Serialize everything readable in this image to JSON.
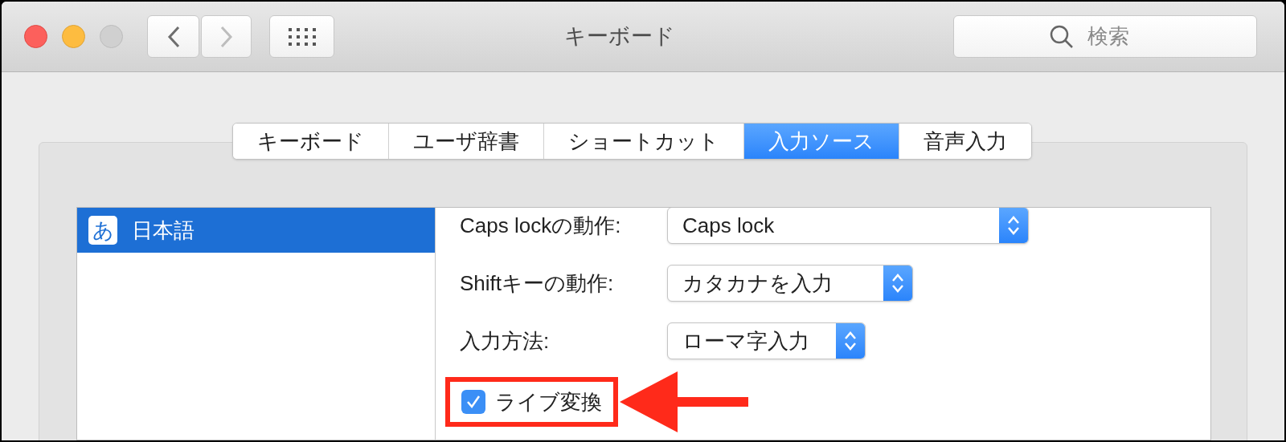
{
  "window": {
    "title": "キーボード"
  },
  "search": {
    "placeholder": "検索"
  },
  "tabs": [
    {
      "label": "キーボード",
      "selected": false
    },
    {
      "label": "ユーザ辞書",
      "selected": false
    },
    {
      "label": "ショートカット",
      "selected": false
    },
    {
      "label": "入力ソース",
      "selected": true
    },
    {
      "label": "音声入力",
      "selected": false
    }
  ],
  "sidebar": {
    "items": [
      {
        "badge": "あ",
        "label": "日本語",
        "selected": true
      }
    ]
  },
  "settings": [
    {
      "kind": "popup",
      "label": "Caps lockの動作:",
      "value": "Caps lock"
    },
    {
      "kind": "popup",
      "label": "Shiftキーの動作:",
      "value": "カタカナを入力"
    },
    {
      "kind": "popup",
      "label": "入力方法:",
      "value": "ローマ字入力"
    },
    {
      "kind": "checkbox",
      "label": "ライブ変換",
      "checked": true,
      "highlighted": true
    }
  ]
}
